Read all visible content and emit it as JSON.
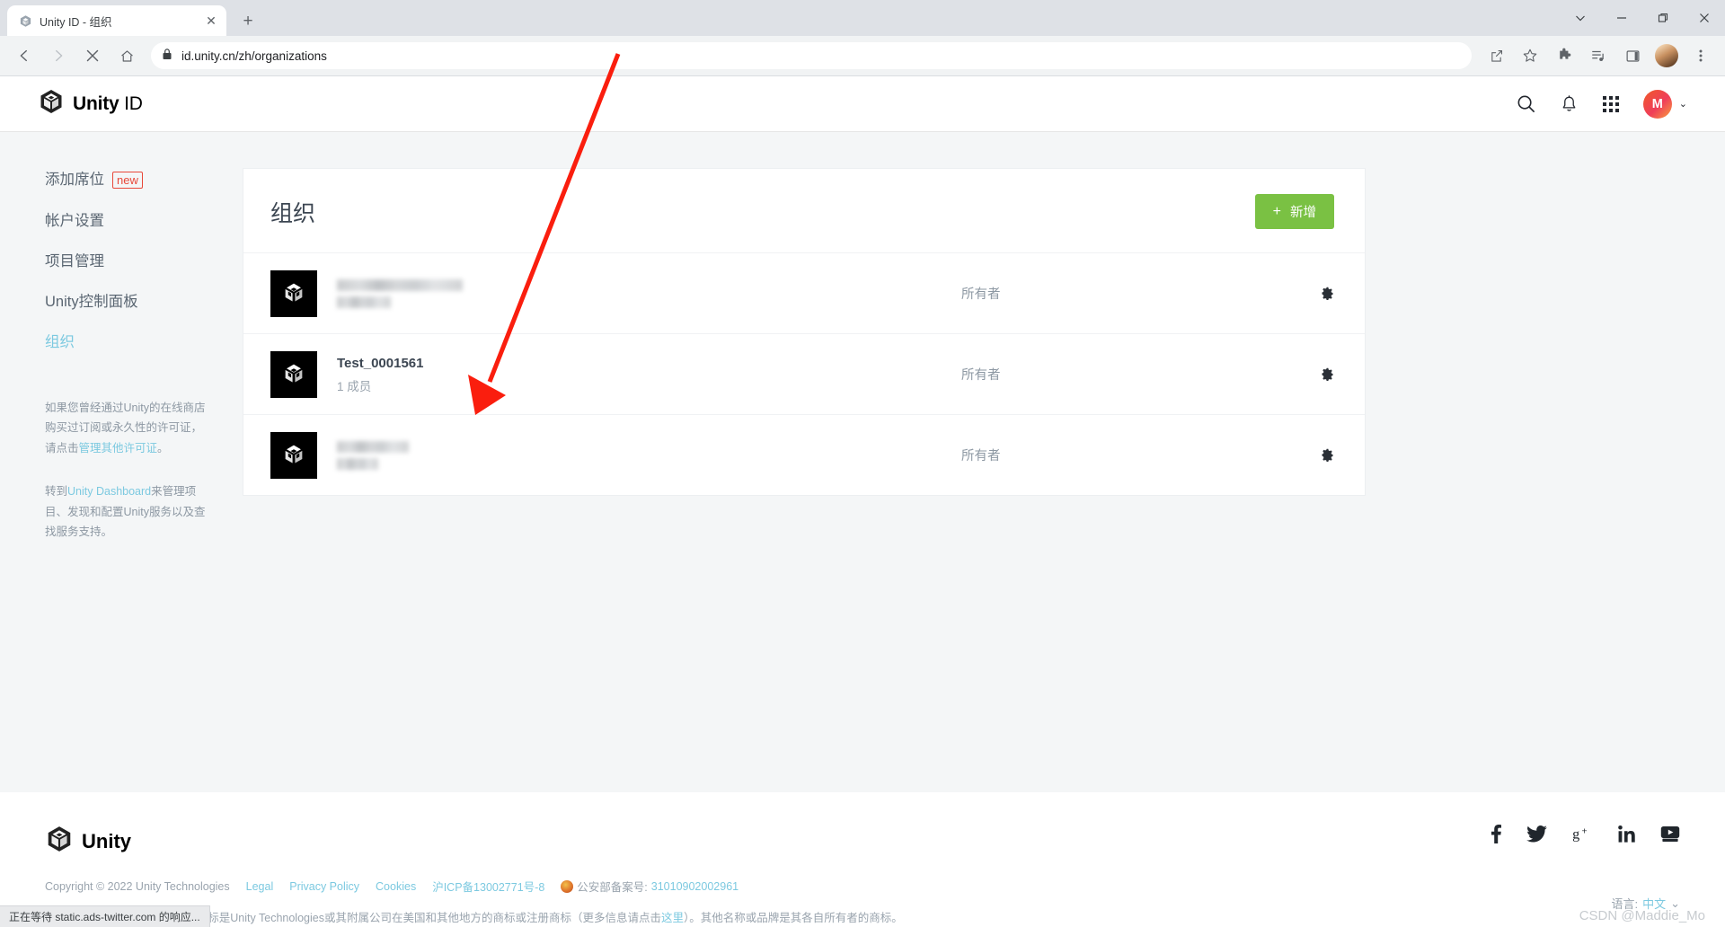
{
  "browser": {
    "tab": {
      "title": "Unity ID - 组织",
      "favicon": "unity-favicon",
      "close_label": "✕"
    },
    "new_tab_label": "+",
    "window_controls": {
      "minimize": "—",
      "maximize": "❐",
      "close": "✕",
      "tab_search": "⌄"
    },
    "nav": {
      "back": "←",
      "forward": "→",
      "stop": "✕",
      "home": "⌂"
    },
    "omnibox": {
      "lock_icon": "lock-icon",
      "url": "id.unity.cn/zh/organizations"
    },
    "toolbar_right": {
      "share": "share-icon",
      "bookmark": "star-icon",
      "extensions": "puzzle-icon",
      "media": "media-list-icon",
      "side_panel": "side-panel-icon",
      "profile": "profile-avatar",
      "menu": "three-dot-menu-icon"
    }
  },
  "header": {
    "logo_bold": "Unity",
    "logo_light": "ID",
    "search_icon": "search-icon",
    "bell_icon": "notification-bell-icon",
    "grid_icon": "apps-grid-icon",
    "avatar_initial": "M",
    "caret": "⌄"
  },
  "sidebar": {
    "items": [
      {
        "label": "添加席位",
        "badge": "new",
        "active": false
      },
      {
        "label": "帐户设置",
        "badge": "",
        "active": false
      },
      {
        "label": "项目管理",
        "badge": "",
        "active": false
      },
      {
        "label": "Unity控制面板",
        "badge": "",
        "active": false
      },
      {
        "label": "组织",
        "badge": "",
        "active": true
      }
    ],
    "note1_pre": "如果您曾经通过Unity的在线商店购买过订阅或永久性的许可证，请点击",
    "note1_link": "管理其他许可证",
    "note1_post": "。",
    "note2_pre": "转到",
    "note2_link": "Unity Dashboard",
    "note2_post": "来管理项目、发现和配置Unity服务以及查找服务支持。"
  },
  "main": {
    "title": "组织",
    "add_button": {
      "plus": "+",
      "label": "新增"
    },
    "rows": [
      {
        "name": "",
        "redacted": true,
        "members": "",
        "role": "所有者",
        "logo": "unity-cube-icon",
        "gear": "gear-icon"
      },
      {
        "name": "Test_0001561",
        "redacted": false,
        "members": "1 成员",
        "role": "所有者",
        "logo": "unity-cube-icon",
        "gear": "gear-icon"
      },
      {
        "name": "",
        "redacted": true,
        "members": "",
        "role": "所有者",
        "logo": "unity-cube-icon",
        "gear": "gear-icon"
      }
    ]
  },
  "footer": {
    "logo_text": "Unity",
    "social": [
      {
        "name": "facebook-icon",
        "glyph": "f"
      },
      {
        "name": "twitter-icon",
        "glyph": "🐦"
      },
      {
        "name": "google-plus-icon",
        "glyph": "g+"
      },
      {
        "name": "linkedin-icon",
        "glyph": "in"
      },
      {
        "name": "youtube-icon",
        "glyph": "▶"
      }
    ],
    "copyright": "Copyright © 2022 Unity Technologies",
    "links": [
      {
        "label": "Legal"
      },
      {
        "label": "Privacy Policy"
      },
      {
        "label": "Cookies"
      },
      {
        "label": "沪ICP备13002771号-8"
      }
    ],
    "gov_label": "公安部备案号:",
    "gov_number": "31010902002961",
    "legal_pre": "“Unity”，Unity徽标和其他Unity商标是Unity Technologies或其附属公司在美国和其他地方的商标或注册商标（更多信息请点击",
    "legal_link": "这里",
    "legal_post": "）。其他名称或品牌是其各自所有者的商标。",
    "language_label": "语言:",
    "language_value": "中文",
    "language_caret": "⌄"
  },
  "status": {
    "text": "正在等待 static.ads-twitter.com 的响应..."
  },
  "watermark": {
    "text": "CSDN @Maddie_Mo"
  },
  "colors": {
    "accent_green": "#7ac143",
    "link_blue": "#7cc9e0",
    "badge_red": "#e8483a",
    "annotation_red": "#fa1e0e",
    "page_bg": "#f4f6f7"
  }
}
